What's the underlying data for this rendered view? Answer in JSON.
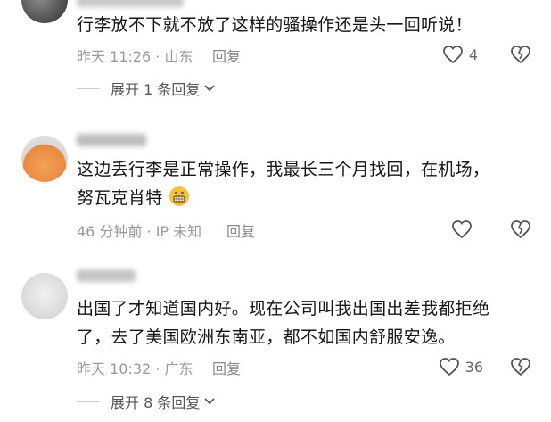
{
  "comments": [
    {
      "content": "行李放不下就不放了这样的骚操作还是头一回听说！",
      "time_location": "昨天 11:26 · 山东",
      "reply_label": "回复",
      "likes": "4",
      "expand_label": "展开 1 条回复"
    },
    {
      "content_line1": "这边丢行李是正常操作，我最长三个月找回，在机场，",
      "content_line2": "努瓦克肖特",
      "time_location": "46 分钟前 · IP 未知",
      "reply_label": "回复",
      "likes": ""
    },
    {
      "content_line1": "出国了才知道国内好。现在公司叫我出国出差我都拒绝",
      "content_line2": "了，去了美国欧洲东南亚，都不如国内舒服安逸。",
      "time_location": "昨天 10:32 · 广东",
      "reply_label": "回复",
      "likes": "36",
      "expand_label": "展开 8 条回复"
    }
  ],
  "colors": {
    "text": "#161616",
    "meta": "#999999",
    "icon": "#666666"
  },
  "icons": [
    "heart-icon",
    "broken-heart-icon",
    "chevron-down-icon",
    "grinning-emoji-icon"
  ]
}
